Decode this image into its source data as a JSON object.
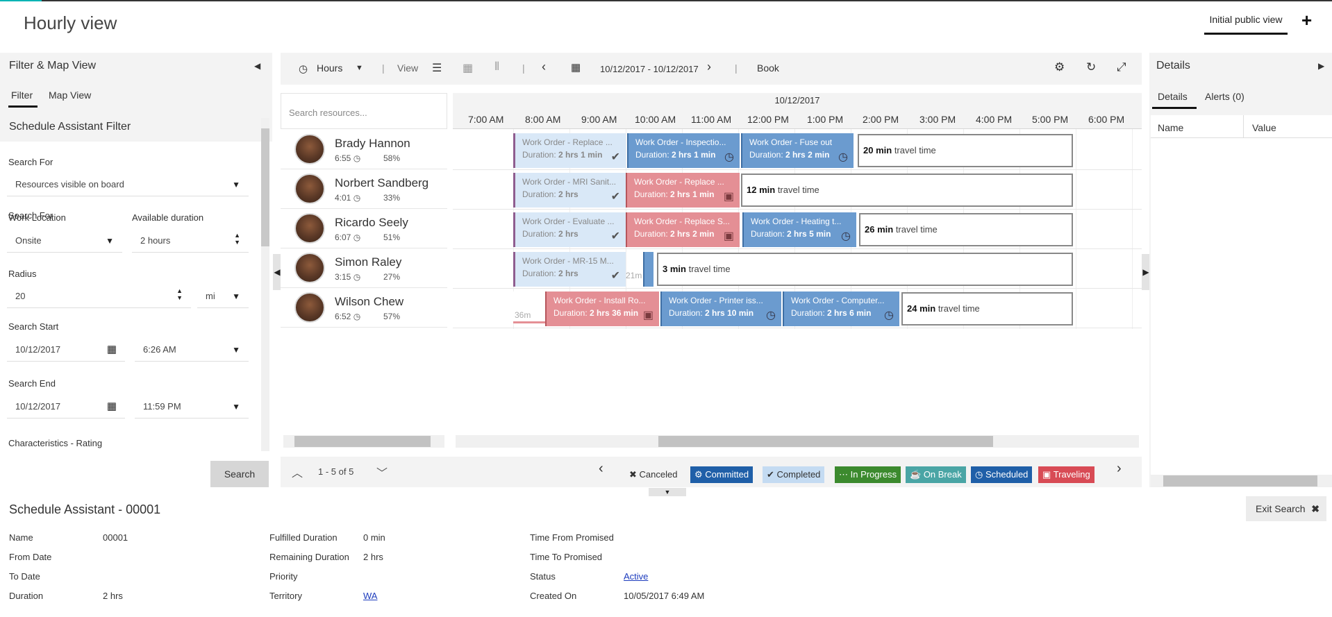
{
  "header": {
    "title": "Hourly view",
    "view_tab": "Initial public view",
    "add_label": "+"
  },
  "left_panel": {
    "title": "Filter & Map View",
    "tabs": [
      "Filter",
      "Map View"
    ],
    "section_title": "Schedule Assistant Filter",
    "search_for_label": "Search For",
    "search_for_value": "Resources visible on board",
    "work_location_label": "Work Location",
    "work_location_value": "Onsite",
    "available_duration_label": "Available duration",
    "available_duration_value": "2 hours",
    "radius_label": "Radius",
    "radius_value": "20",
    "radius_unit": "mi",
    "search_start_label": "Search Start",
    "search_start_date": "10/12/2017",
    "search_start_time": "6:26 AM",
    "search_end_label": "Search End",
    "search_end_date": "10/12/2017",
    "search_end_time": "11:59 PM",
    "characteristics_label": "Characteristics - Rating",
    "search_button": "Search"
  },
  "toolbar": {
    "hours_label": "Hours",
    "view_label": "View",
    "date_range": "10/12/2017 - 10/12/2017",
    "book_label": "Book"
  },
  "resources": {
    "search_placeholder": "Search resources...",
    "items": [
      {
        "name": "Brady Hannon",
        "time": "6:55",
        "pct": "58%"
      },
      {
        "name": "Norbert Sandberg",
        "time": "4:01",
        "pct": "33%"
      },
      {
        "name": "Ricardo Seely",
        "time": "6:07",
        "pct": "51%"
      },
      {
        "name": "Simon Raley",
        "time": "3:15",
        "pct": "27%"
      },
      {
        "name": "Wilson Chew",
        "time": "6:52",
        "pct": "57%"
      }
    ]
  },
  "schedule": {
    "date": "10/12/2017",
    "hours": [
      "7:00 AM",
      "8:00 AM",
      "9:00 AM",
      "10:00 AM",
      "11:00 AM",
      "12:00 PM",
      "1:00 PM",
      "2:00 PM",
      "3:00 PM",
      "4:00 PM",
      "5:00 PM",
      "6:00 PM"
    ],
    "duration_label": "Duration:",
    "travel_suffix": "travel time",
    "rows": [
      {
        "blocks": [
          {
            "title": "Work Order - Replace ...",
            "duration": "2 hrs 1 min",
            "status": "Completed"
          },
          {
            "title": "Work Order - Inspectio...",
            "duration": "2 hrs 1 min",
            "status": "Scheduled"
          },
          {
            "title": "Work Order - Fuse out",
            "duration": "2 hrs 2 min",
            "status": "Scheduled"
          }
        ],
        "travel": "20 min"
      },
      {
        "blocks": [
          {
            "title": "Work Order - MRI Sanit...",
            "duration": "2 hrs",
            "status": "Completed"
          },
          {
            "title": "Work Order - Replace ...",
            "duration": "2 hrs 1 min",
            "status": "Traveling"
          }
        ],
        "travel": "12 min"
      },
      {
        "blocks": [
          {
            "title": "Work Order - Evaluate ...",
            "duration": "2 hrs",
            "status": "Completed"
          },
          {
            "title": "Work Order - Replace S...",
            "duration": "2 hrs 2 min",
            "status": "Traveling"
          },
          {
            "title": "Work Order - Heating t...",
            "duration": "2 hrs 5 min",
            "status": "Scheduled"
          }
        ],
        "travel": "26 min"
      },
      {
        "blocks": [
          {
            "title": "Work Order - MR-15 M...",
            "duration": "2 hrs",
            "status": "Completed"
          }
        ],
        "small_label": "21m",
        "travel": "3 min"
      },
      {
        "blocks": [
          {
            "title": "Work Order - Install Ro...",
            "duration": "2 hrs 36 min",
            "status": "Traveling"
          },
          {
            "title": "Work Order - Printer iss...",
            "duration": "2 hrs 10 min",
            "status": "Scheduled"
          },
          {
            "title": "Work Order - Computer...",
            "duration": "2 hrs 6 min",
            "status": "Scheduled"
          }
        ],
        "small_label": "36m",
        "travel": "24 min"
      }
    ]
  },
  "pager": {
    "label": "1 - 5 of 5"
  },
  "legend": [
    {
      "label": "Canceled",
      "color": "#f3f3f3",
      "text": "#333",
      "icon": "close-icon"
    },
    {
      "label": "Committed",
      "color": "#1f5fa8",
      "text": "#ffffff",
      "icon": "gear-icon"
    },
    {
      "label": "Completed",
      "color": "#c4dbf2",
      "text": "#333",
      "icon": "check-icon"
    },
    {
      "label": "In Progress",
      "color": "#3c8a2e",
      "text": "#ffffff",
      "icon": "dots-icon"
    },
    {
      "label": "On Break",
      "color": "#4aa5a5",
      "text": "#ffffff",
      "icon": "coffee-icon"
    },
    {
      "label": "Scheduled",
      "color": "#1f5fa8",
      "text": "#ffffff",
      "icon": "clock-icon"
    },
    {
      "label": "Traveling",
      "color": "#d84b55",
      "text": "#ffffff",
      "icon": "briefcase-icon"
    }
  ],
  "right_panel": {
    "title": "Details",
    "tabs": [
      "Details",
      "Alerts (0)"
    ],
    "columns": [
      "Name",
      "Value"
    ]
  },
  "details": {
    "title": "Schedule Assistant - 00001",
    "exit_label": "Exit Search",
    "col1": [
      {
        "label": "Name",
        "value": "00001"
      },
      {
        "label": "From Date",
        "value": ""
      },
      {
        "label": "To Date",
        "value": ""
      },
      {
        "label": "Duration",
        "value": "2 hrs"
      }
    ],
    "col2": [
      {
        "label": "Fulfilled Duration",
        "value": "0 min"
      },
      {
        "label": "Remaining Duration",
        "value": "2 hrs"
      },
      {
        "label": "Priority",
        "value": ""
      },
      {
        "label": "Territory",
        "value": "WA"
      }
    ],
    "col3": [
      {
        "label": "Time From Promised",
        "value": ""
      },
      {
        "label": "Time To Promised",
        "value": ""
      },
      {
        "label": "Status",
        "value": "Active"
      },
      {
        "label": "Created On",
        "value": "10/05/2017 6:49 AM"
      }
    ]
  }
}
